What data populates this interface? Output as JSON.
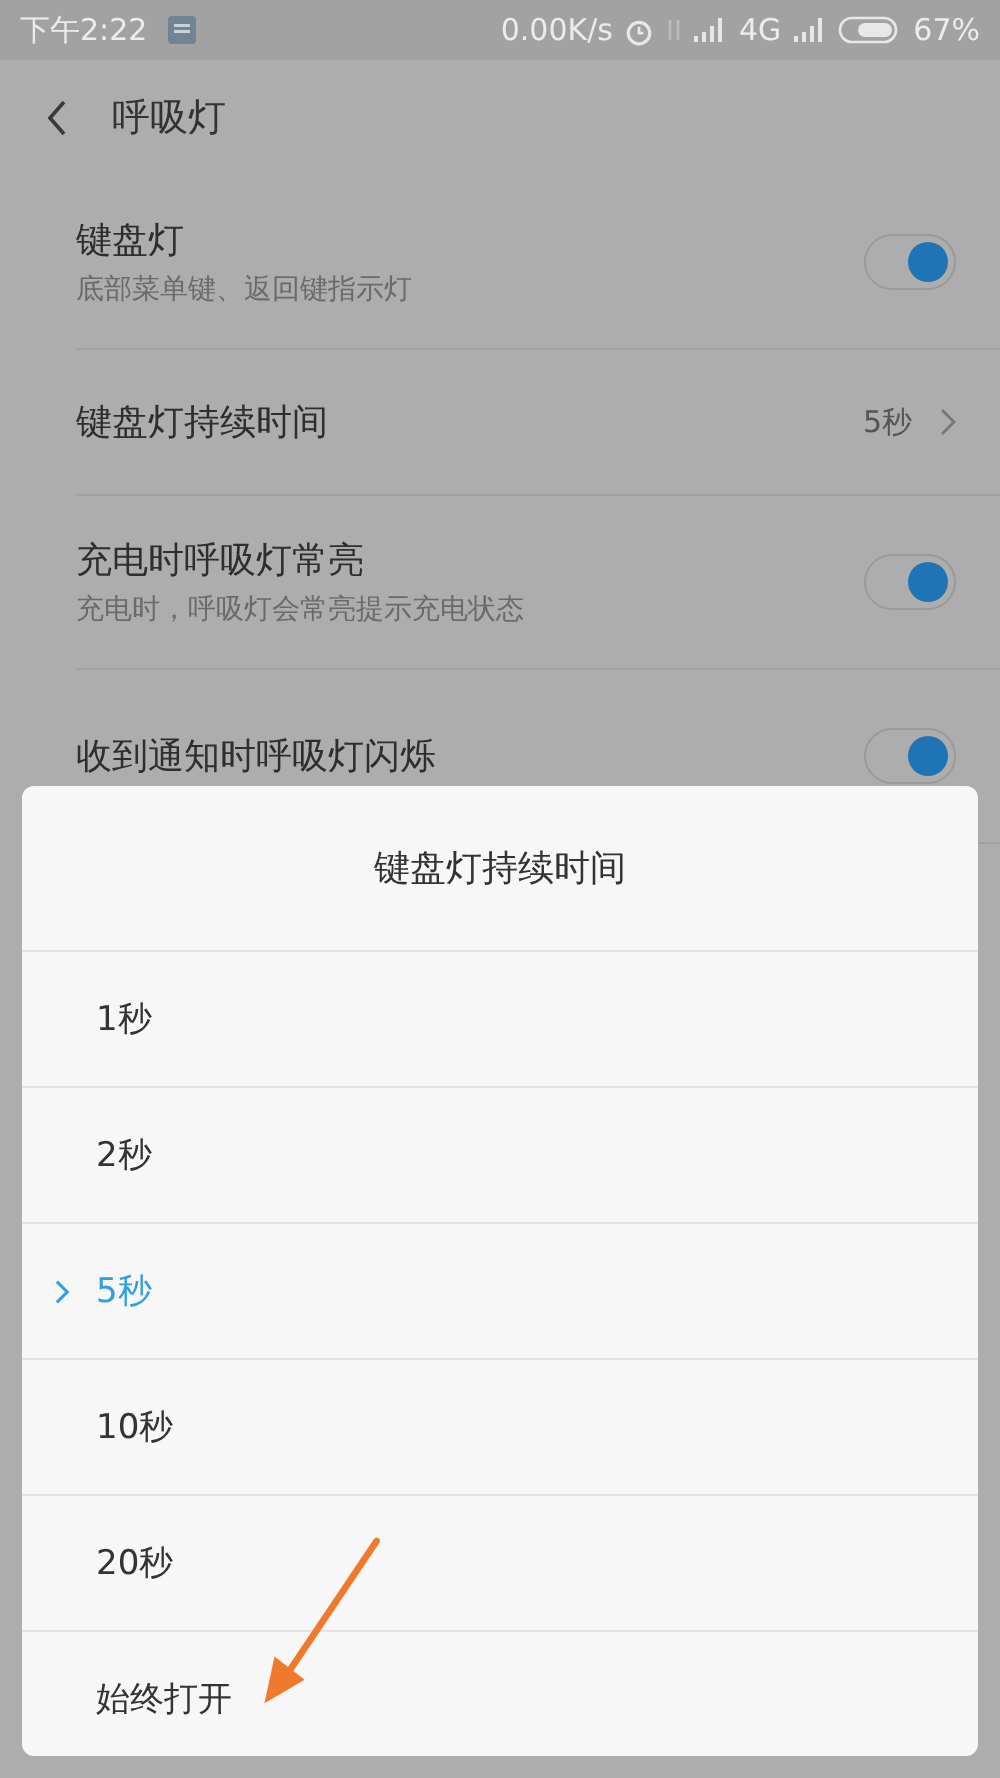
{
  "status_bar": {
    "time": "下午2:22",
    "speed": "0.00K/s",
    "network": "4G",
    "battery": "67%"
  },
  "header": {
    "title": "呼吸灯"
  },
  "settings": [
    {
      "kind": "toggle",
      "title": "键盘灯",
      "subtitle": "底部菜单键、返回键指示灯",
      "on": true
    },
    {
      "kind": "link",
      "title": "键盘灯持续时间",
      "value": "5秒"
    },
    {
      "kind": "toggle",
      "title": "充电时呼吸灯常亮",
      "subtitle": "充电时，呼吸灯会常亮提示充电状态",
      "on": true
    },
    {
      "kind": "toggle",
      "title": "收到通知时呼吸灯闪烁",
      "on": true
    }
  ],
  "dialog": {
    "title": "键盘灯持续时间",
    "options": [
      {
        "label": "1秒",
        "selected": false
      },
      {
        "label": "2秒",
        "selected": false
      },
      {
        "label": "5秒",
        "selected": true
      },
      {
        "label": "10秒",
        "selected": false
      },
      {
        "label": "20秒",
        "selected": false
      },
      {
        "label": "始终打开",
        "selected": false
      }
    ]
  }
}
